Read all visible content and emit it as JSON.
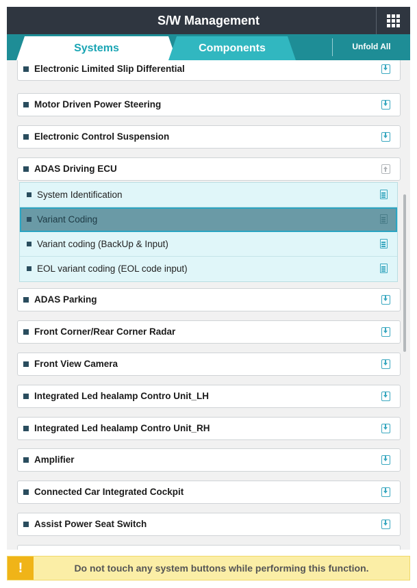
{
  "header": {
    "title": "S/W Management",
    "menu_icon": "grid-icon"
  },
  "tabs": [
    {
      "label": "Systems",
      "active": true
    },
    {
      "label": "Components",
      "active": false
    }
  ],
  "unfold_all_label": "Unfold All",
  "systems": [
    {
      "label": "Electronic Limited Slip Differential",
      "state": "collapsed"
    },
    {
      "label": "Motor Driven Power Steering",
      "state": "collapsed"
    },
    {
      "label": "Electronic Control Suspension",
      "state": "collapsed"
    },
    {
      "label": "ADAS Driving ECU",
      "state": "expanded"
    },
    {
      "label": "ADAS Parking",
      "state": "collapsed"
    },
    {
      "label": "Front Corner/Rear Corner Radar",
      "state": "collapsed"
    },
    {
      "label": "Front View Camera",
      "state": "collapsed"
    },
    {
      "label": "Integrated Led healamp Contro Unit_LH",
      "state": "collapsed"
    },
    {
      "label": "Integrated Led healamp Contro Unit_RH",
      "state": "collapsed"
    },
    {
      "label": "Amplifier",
      "state": "collapsed"
    },
    {
      "label": "Connected Car Integrated Cockpit",
      "state": "collapsed"
    },
    {
      "label": "Assist Power Seat Switch",
      "state": "collapsed"
    }
  ],
  "sub_items": [
    {
      "label": "System Identification",
      "selected": false
    },
    {
      "label": "Variant Coding",
      "selected": true
    },
    {
      "label": "Variant coding (BackUp & Input)",
      "selected": false
    },
    {
      "label": "EOL variant coding (EOL code input)",
      "selected": false
    }
  ],
  "warning": {
    "mark": "!",
    "text": "Do not touch any system buttons while performing this function."
  },
  "colors": {
    "header": "#2f3640",
    "tabbar": "#1e8d96",
    "accent": "#1aa5b4",
    "selected": "#6a9aa6",
    "warning": "#fbeea6"
  }
}
